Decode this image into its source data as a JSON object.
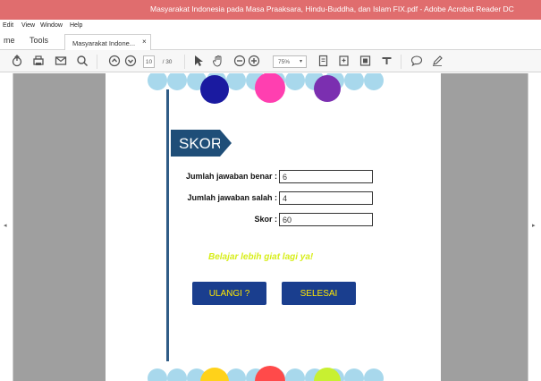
{
  "window": {
    "title": "Masyarakat Indonesia pada Masa Praaksara, Hindu-Buddha, dan Islam FIX.pdf - Adobe Acrobat Reader DC"
  },
  "menu": {
    "edit": "Edit",
    "view": "View",
    "window": "Window",
    "help": "Help"
  },
  "tabs": {
    "home": "me",
    "tools": "Tools",
    "document": "Masyarakat Indone...",
    "close": "×"
  },
  "toolbar": {
    "page_current": "10",
    "page_total": "/ 30",
    "zoom": "75%"
  },
  "document": {
    "skor_title": "SKOR",
    "fields": [
      {
        "label": "Jumlah jawaban benar :",
        "value": "6"
      },
      {
        "label": "Jumlah jawaban salah :",
        "value": "4"
      },
      {
        "label": "Skor :",
        "value": "60"
      }
    ],
    "motto": "Belajar lebih giat lagi ya!",
    "buttons": {
      "ulangi": "ULANGI ?",
      "selesai": "SELESAI"
    }
  },
  "colors": {
    "titlebar": "#e06d6e",
    "skor_banner": "#1f4e78",
    "button_bg": "#1a3e8e",
    "button_text": "#ffe800",
    "motto": "#d7ee1a",
    "top_dots": [
      "#1a1aa0",
      "#ff3fb0",
      "#7b2fb0"
    ],
    "bottom_dots": [
      "#ffd21a",
      "#ff4a4a",
      "#c8f031"
    ],
    "scallop": "#a8d8ec"
  }
}
